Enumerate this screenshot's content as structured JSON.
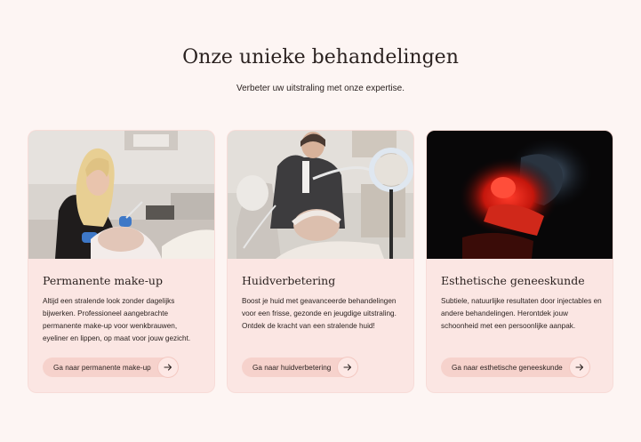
{
  "section": {
    "title": "Onze unieke behandelingen",
    "subtitle": "Verbeter uw uitstraling met onze expertise."
  },
  "cards": [
    {
      "title": "Permanente make-up",
      "text": "Altijd een stralende look zonder dagelijks bijwerken. Professioneel aangebrachte permanente make-up voor wenkbrauwen, eyeliner en lippen, op maat voor jouw gezicht.",
      "button": "Ga naar permanente make-up"
    },
    {
      "title": "Huidverbetering",
      "text": "Boost je huid met geavanceerde behandelingen voor een frisse, gezonde en jeugdige uitstraling. Ontdek de kracht van een stralende huid!",
      "button": "Ga naar huidverbetering"
    },
    {
      "title": "Esthetische geneeskunde",
      "text": "Subtiele, natuurlijke resultaten door injectables en andere behandelingen. Herontdek jouw schoonheid met een persoonlijke aanpak.",
      "button": "Ga naar esthetische geneeskunde"
    }
  ],
  "icons": {
    "button_arrow": "arrow-right-icon"
  },
  "colors": {
    "page_bg": "#fdf5f3",
    "card_bg": "#fbe6e3",
    "button_bg": "#f6d2cc",
    "text": "#2b2220"
  }
}
